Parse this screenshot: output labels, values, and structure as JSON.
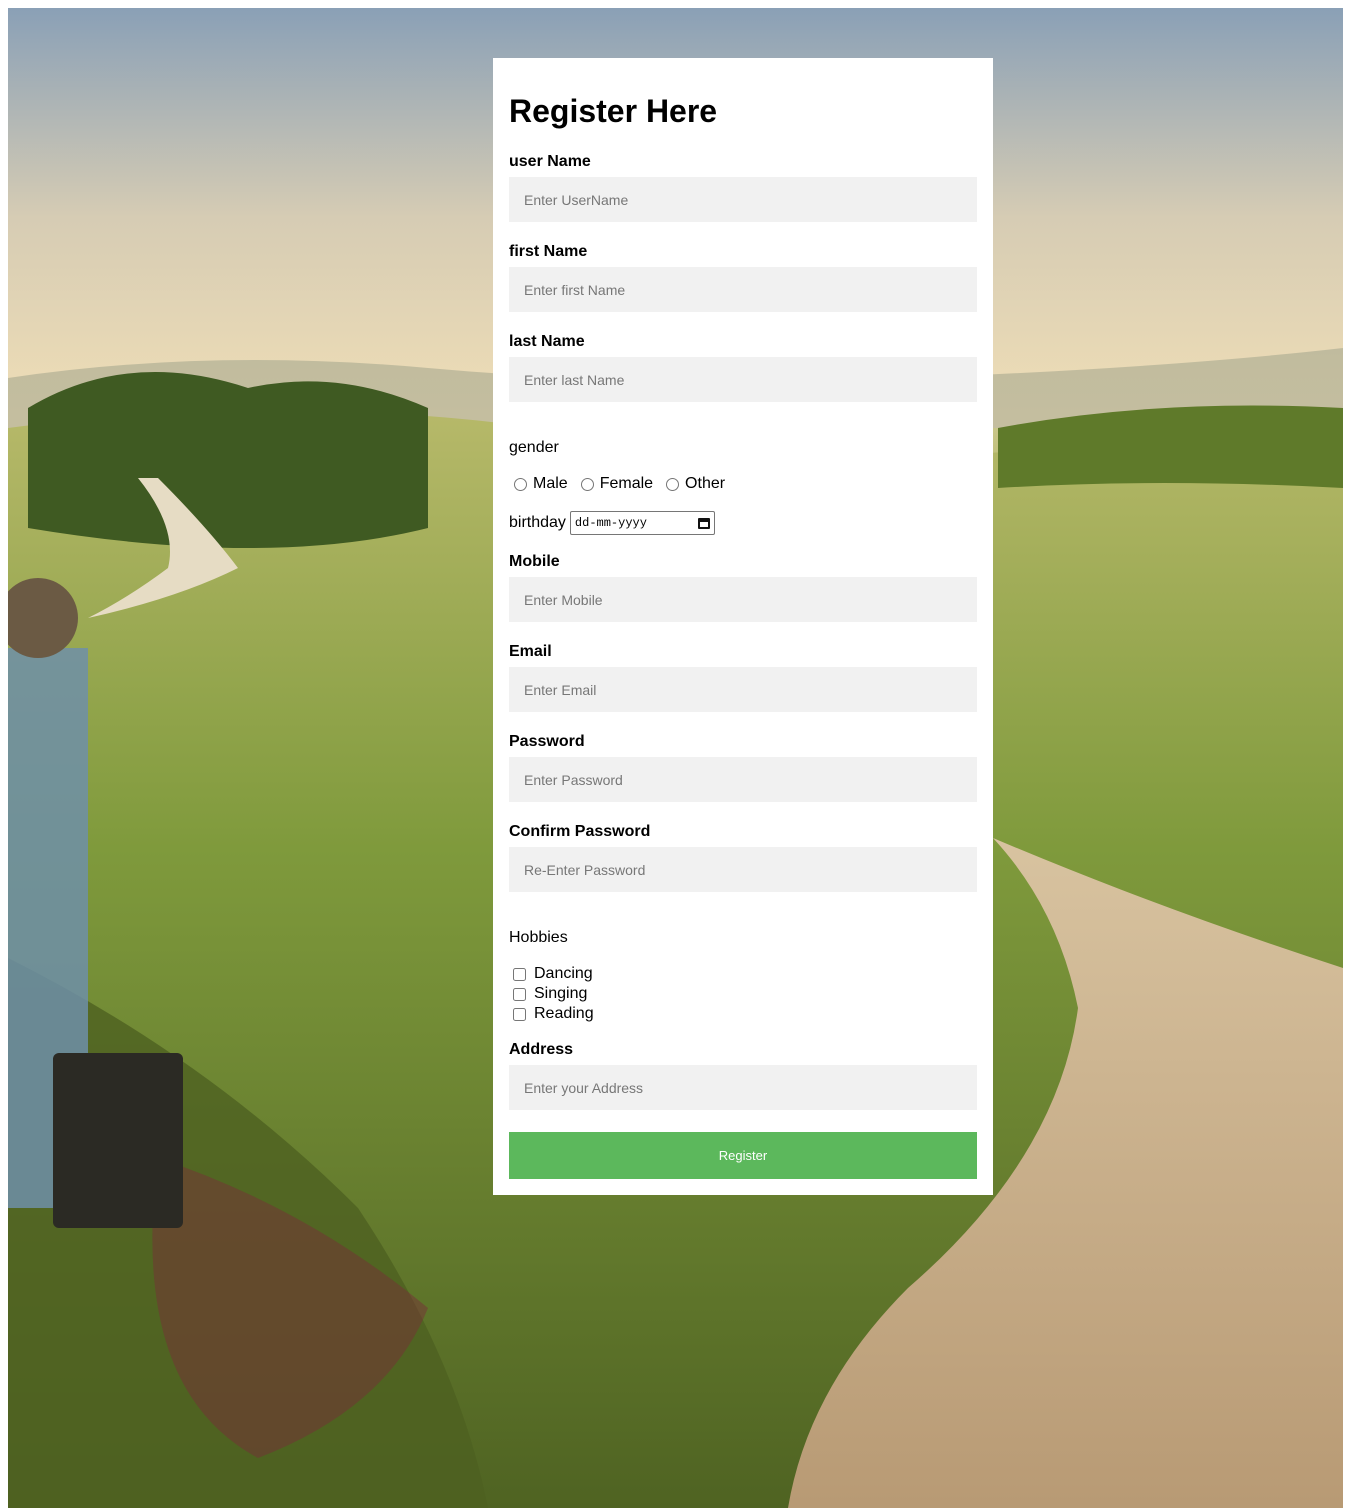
{
  "form": {
    "title": "Register Here",
    "username": {
      "label": "user Name",
      "placeholder": "Enter UserName"
    },
    "first_name": {
      "label": "first Name",
      "placeholder": "Enter first Name"
    },
    "last_name": {
      "label": "last Name",
      "placeholder": "Enter last Name"
    },
    "gender": {
      "label": "gender",
      "options": [
        "Male",
        "Female",
        "Other"
      ]
    },
    "birthday": {
      "label": "birthday",
      "placeholder": "dd-mm-yyyy"
    },
    "mobile": {
      "label": "Mobile",
      "placeholder": "Enter Mobile"
    },
    "email": {
      "label": "Email",
      "placeholder": "Enter Email"
    },
    "password": {
      "label": "Password",
      "placeholder": "Enter Password"
    },
    "confirm_password": {
      "label": "Confirm Password",
      "placeholder": "Re-Enter Password"
    },
    "hobbies": {
      "label": "Hobbies",
      "options": [
        "Dancing",
        "Singing",
        "Reading"
      ]
    },
    "address": {
      "label": "Address",
      "placeholder": "Enter your Address"
    },
    "submit_label": "Register"
  },
  "colors": {
    "button": "#5cb85c",
    "input_bg": "#f1f1f1",
    "card_bg": "#ffffff"
  }
}
